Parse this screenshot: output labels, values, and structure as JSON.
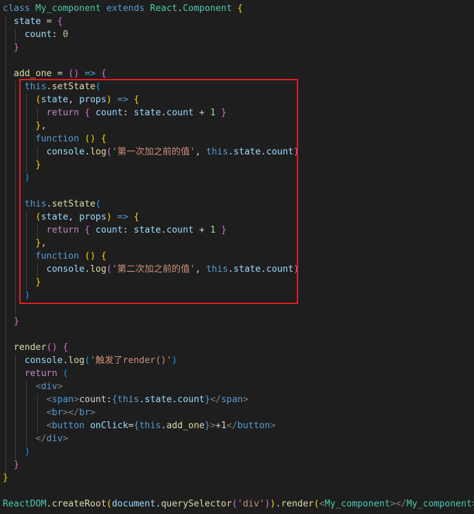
{
  "code": {
    "lines": [
      [
        [
          "kw",
          "class"
        ],
        [
          "pn",
          " "
        ],
        [
          "cls",
          "My_component"
        ],
        [
          "pn",
          " "
        ],
        [
          "kw",
          "extends"
        ],
        [
          "pn",
          " "
        ],
        [
          "cls",
          "React"
        ],
        [
          "pn",
          "."
        ],
        [
          "cls",
          "Component"
        ],
        [
          "pn",
          " "
        ],
        [
          "b1",
          "{"
        ]
      ],
      [
        [
          "pn",
          "  "
        ],
        [
          "var",
          "state"
        ],
        [
          "pn",
          " = "
        ],
        [
          "b2",
          "{"
        ]
      ],
      [
        [
          "pn",
          "    "
        ],
        [
          "var",
          "count"
        ],
        [
          "pn",
          ": "
        ],
        [
          "num",
          "0"
        ]
      ],
      [
        [
          "pn",
          "  "
        ],
        [
          "b2",
          "}"
        ]
      ],
      [
        [
          "pn",
          ""
        ]
      ],
      [
        [
          "pn",
          "  "
        ],
        [
          "fn",
          "add_one"
        ],
        [
          "pn",
          " = "
        ],
        [
          "b2",
          "()"
        ],
        [
          "pn",
          " "
        ],
        [
          "kw",
          "=>"
        ],
        [
          "pn",
          " "
        ],
        [
          "b2",
          "{"
        ]
      ],
      [
        [
          "pn",
          "    "
        ],
        [
          "kw",
          "this"
        ],
        [
          "pn",
          "."
        ],
        [
          "fn",
          "setState"
        ],
        [
          "b3",
          "("
        ]
      ],
      [
        [
          "pn",
          "      "
        ],
        [
          "b1",
          "("
        ],
        [
          "var",
          "state"
        ],
        [
          "pn",
          ", "
        ],
        [
          "var",
          "props"
        ],
        [
          "b1",
          ")"
        ],
        [
          "pn",
          " "
        ],
        [
          "kw",
          "=>"
        ],
        [
          "pn",
          " "
        ],
        [
          "b1",
          "{"
        ]
      ],
      [
        [
          "pn",
          "        "
        ],
        [
          "ctl",
          "return"
        ],
        [
          "pn",
          " "
        ],
        [
          "b2",
          "{"
        ],
        [
          "pn",
          " "
        ],
        [
          "var",
          "count"
        ],
        [
          "pn",
          ": "
        ],
        [
          "var",
          "state"
        ],
        [
          "pn",
          "."
        ],
        [
          "var",
          "count"
        ],
        [
          "pn",
          " + "
        ],
        [
          "num",
          "1"
        ],
        [
          "pn",
          " "
        ],
        [
          "b2",
          "}"
        ]
      ],
      [
        [
          "pn",
          "      "
        ],
        [
          "b1",
          "}"
        ],
        [
          "pn",
          ","
        ]
      ],
      [
        [
          "pn",
          "      "
        ],
        [
          "kw",
          "function"
        ],
        [
          "pn",
          " "
        ],
        [
          "b1",
          "()"
        ],
        [
          "pn",
          " "
        ],
        [
          "b1",
          "{"
        ]
      ],
      [
        [
          "pn",
          "        "
        ],
        [
          "var",
          "console"
        ],
        [
          "pn",
          "."
        ],
        [
          "fn",
          "log"
        ],
        [
          "b2",
          "("
        ],
        [
          "str",
          "'第一次加之前的值'"
        ],
        [
          "pn",
          ", "
        ],
        [
          "kw",
          "this"
        ],
        [
          "pn",
          "."
        ],
        [
          "var",
          "state"
        ],
        [
          "pn",
          "."
        ],
        [
          "var",
          "count"
        ],
        [
          "b2",
          ")"
        ]
      ],
      [
        [
          "pn",
          "      "
        ],
        [
          "b1",
          "}"
        ]
      ],
      [
        [
          "pn",
          "    "
        ],
        [
          "b3",
          ")"
        ]
      ],
      [
        [
          "pn",
          ""
        ]
      ],
      [
        [
          "pn",
          "    "
        ],
        [
          "kw",
          "this"
        ],
        [
          "pn",
          "."
        ],
        [
          "fn",
          "setState"
        ],
        [
          "b3",
          "("
        ]
      ],
      [
        [
          "pn",
          "      "
        ],
        [
          "b1",
          "("
        ],
        [
          "var",
          "state"
        ],
        [
          "pn",
          ", "
        ],
        [
          "var",
          "props"
        ],
        [
          "b1",
          ")"
        ],
        [
          "pn",
          " "
        ],
        [
          "kw",
          "=>"
        ],
        [
          "pn",
          " "
        ],
        [
          "b1",
          "{"
        ]
      ],
      [
        [
          "pn",
          "        "
        ],
        [
          "ctl",
          "return"
        ],
        [
          "pn",
          " "
        ],
        [
          "b2",
          "{"
        ],
        [
          "pn",
          " "
        ],
        [
          "var",
          "count"
        ],
        [
          "pn",
          ": "
        ],
        [
          "var",
          "state"
        ],
        [
          "pn",
          "."
        ],
        [
          "var",
          "count"
        ],
        [
          "pn",
          " + "
        ],
        [
          "num",
          "1"
        ],
        [
          "pn",
          " "
        ],
        [
          "b2",
          "}"
        ]
      ],
      [
        [
          "pn",
          "      "
        ],
        [
          "b1",
          "}"
        ],
        [
          "pn",
          ","
        ]
      ],
      [
        [
          "pn",
          "      "
        ],
        [
          "kw",
          "function"
        ],
        [
          "pn",
          " "
        ],
        [
          "b1",
          "()"
        ],
        [
          "pn",
          " "
        ],
        [
          "b1",
          "{"
        ]
      ],
      [
        [
          "pn",
          "        "
        ],
        [
          "var",
          "console"
        ],
        [
          "pn",
          "."
        ],
        [
          "fn",
          "log"
        ],
        [
          "b2",
          "("
        ],
        [
          "str",
          "'第二次加之前的值'"
        ],
        [
          "pn",
          ", "
        ],
        [
          "kw",
          "this"
        ],
        [
          "pn",
          "."
        ],
        [
          "var",
          "state"
        ],
        [
          "pn",
          "."
        ],
        [
          "var",
          "count"
        ],
        [
          "b2",
          ")"
        ]
      ],
      [
        [
          "pn",
          "      "
        ],
        [
          "b1",
          "}"
        ]
      ],
      [
        [
          "pn",
          "    "
        ],
        [
          "b3",
          ")"
        ]
      ],
      [
        [
          "pn",
          ""
        ]
      ],
      [
        [
          "pn",
          "  "
        ],
        [
          "b2",
          "}"
        ]
      ],
      [
        [
          "pn",
          ""
        ]
      ],
      [
        [
          "pn",
          "  "
        ],
        [
          "fn",
          "render"
        ],
        [
          "b2",
          "()"
        ],
        [
          "pn",
          " "
        ],
        [
          "b2",
          "{"
        ]
      ],
      [
        [
          "pn",
          "    "
        ],
        [
          "var",
          "console"
        ],
        [
          "pn",
          "."
        ],
        [
          "fn",
          "log"
        ],
        [
          "b3",
          "("
        ],
        [
          "str",
          "'触发了render()'"
        ],
        [
          "b3",
          ")"
        ]
      ],
      [
        [
          "pn",
          "    "
        ],
        [
          "ctl",
          "return"
        ],
        [
          "pn",
          " "
        ],
        [
          "b3",
          "("
        ]
      ],
      [
        [
          "pn",
          "      "
        ],
        [
          "tag",
          "<"
        ],
        [
          "tg",
          "div"
        ],
        [
          "tag",
          ">"
        ]
      ],
      [
        [
          "pn",
          "        "
        ],
        [
          "tag",
          "<"
        ],
        [
          "tg",
          "span"
        ],
        [
          "tag",
          ">"
        ],
        [
          "pn",
          "count:"
        ],
        [
          "kw",
          "{"
        ],
        [
          "kw",
          "this"
        ],
        [
          "pn",
          "."
        ],
        [
          "var",
          "state"
        ],
        [
          "pn",
          "."
        ],
        [
          "var",
          "count"
        ],
        [
          "kw",
          "}"
        ],
        [
          "tag",
          "</"
        ],
        [
          "tg",
          "span"
        ],
        [
          "tag",
          ">"
        ]
      ],
      [
        [
          "pn",
          "        "
        ],
        [
          "tag",
          "<"
        ],
        [
          "tg",
          "br"
        ],
        [
          "tag",
          "></"
        ],
        [
          "tg",
          "br"
        ],
        [
          "tag",
          ">"
        ]
      ],
      [
        [
          "pn",
          "        "
        ],
        [
          "tag",
          "<"
        ],
        [
          "tg",
          "button"
        ],
        [
          "pn",
          " "
        ],
        [
          "var",
          "onClick"
        ],
        [
          "pn",
          "="
        ],
        [
          "kw",
          "{"
        ],
        [
          "kw",
          "this"
        ],
        [
          "pn",
          "."
        ],
        [
          "fn",
          "add_one"
        ],
        [
          "kw",
          "}"
        ],
        [
          "tag",
          ">"
        ],
        [
          "pn",
          "+1"
        ],
        [
          "tag",
          "</"
        ],
        [
          "tg",
          "button"
        ],
        [
          "tag",
          ">"
        ]
      ],
      [
        [
          "pn",
          "      "
        ],
        [
          "tag",
          "</"
        ],
        [
          "tg",
          "div"
        ],
        [
          "tag",
          ">"
        ]
      ],
      [
        [
          "pn",
          "    "
        ],
        [
          "b3",
          ")"
        ]
      ],
      [
        [
          "pn",
          "  "
        ],
        [
          "b2",
          "}"
        ]
      ],
      [
        [
          "b1",
          "}"
        ]
      ],
      [
        [
          "pn",
          ""
        ]
      ],
      [
        [
          "cls",
          "ReactDOM"
        ],
        [
          "pn",
          "."
        ],
        [
          "fn",
          "createRoot"
        ],
        [
          "b1",
          "("
        ],
        [
          "var",
          "document"
        ],
        [
          "pn",
          "."
        ],
        [
          "fn",
          "querySelector"
        ],
        [
          "b2",
          "("
        ],
        [
          "str",
          "'div'"
        ],
        [
          "b2",
          ")"
        ],
        [
          "b1",
          ")"
        ],
        [
          "pn",
          "."
        ],
        [
          "fn",
          "render"
        ],
        [
          "b1",
          "("
        ],
        [
          "tag",
          "<"
        ],
        [
          "tcomp",
          "My_component"
        ],
        [
          "tag",
          "></"
        ],
        [
          "tcomp",
          "My_component"
        ],
        [
          "tag",
          ">"
        ],
        [
          "b1",
          ")"
        ]
      ]
    ]
  }
}
